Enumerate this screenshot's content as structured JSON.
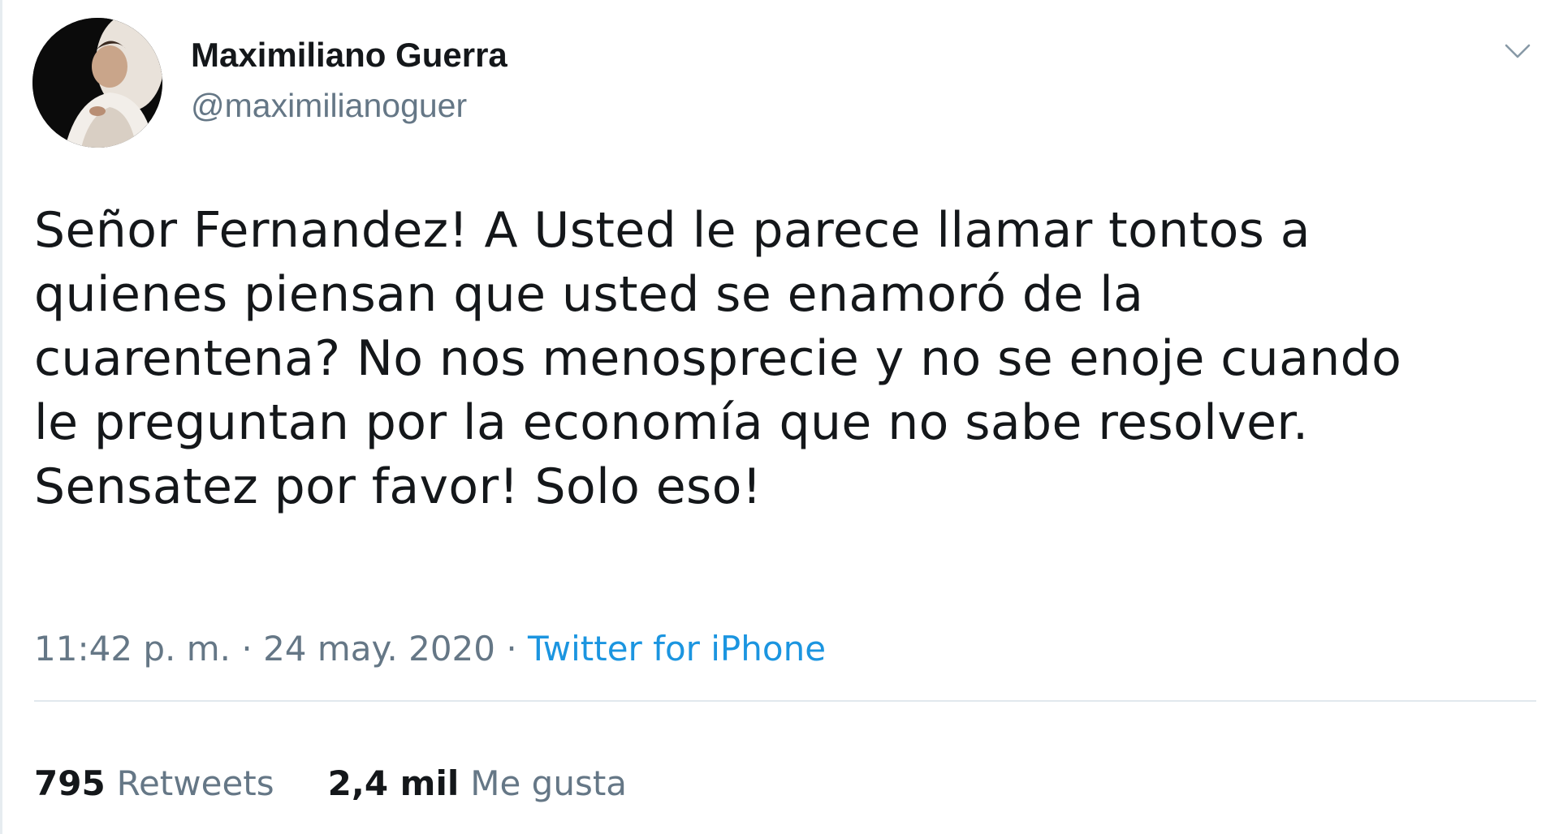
{
  "user": {
    "display_name": "Maximiliano Guerra",
    "handle": "@maximilianoguer"
  },
  "tweet": {
    "text": "Señor Fernandez! A Usted le parece llamar tontos a\nquienes piensan que usted se enamoró de la\ncuarentena? No nos menosprecie y no se enoje cuando\nle preguntan por la economía que no sabe resolver.\nSensatez por favor! Solo eso!",
    "time": "11:42 p. m.",
    "separator": "·",
    "date": "24 may. 2020",
    "source": "Twitter for iPhone"
  },
  "stats": {
    "retweets_count": "795",
    "retweets_label": "Retweets",
    "likes_count": "2,4 mil",
    "likes_label": "Me gusta"
  },
  "icons": {
    "menu": "chevron-down-icon"
  },
  "colors": {
    "text": "#14171a",
    "secondary": "#657786",
    "link": "#1b95e0",
    "divider": "#e1e8ed"
  }
}
